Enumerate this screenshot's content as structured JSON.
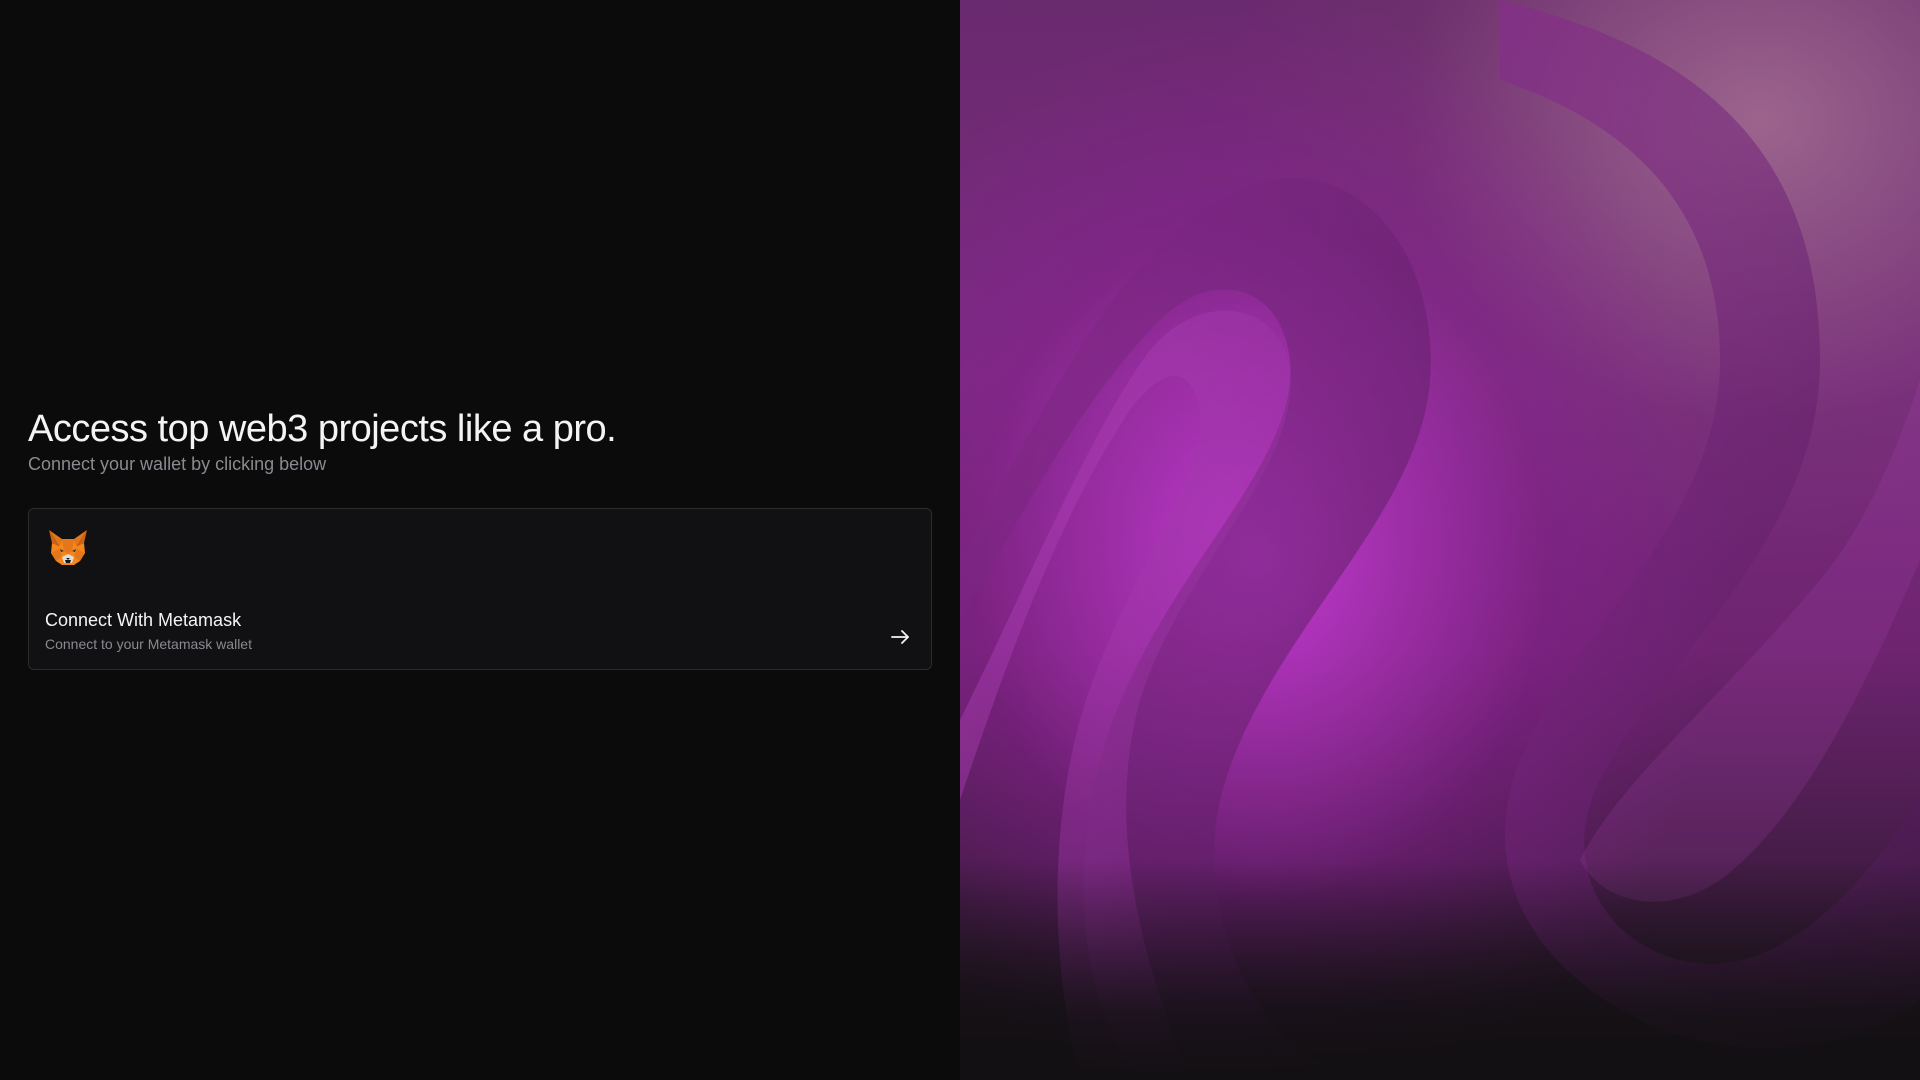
{
  "hero": {
    "headline": "Access top web3 projects like a pro.",
    "subhead": "Connect your wallet by clicking below"
  },
  "wallet_option": {
    "icon": "metamask-fox-icon",
    "title": "Connect With Metamask",
    "subtitle": "Connect to your Metamask wallet",
    "action_icon": "arrow-right-icon"
  },
  "colors": {
    "background": "#0b0b0c",
    "card_background": "#111113",
    "card_border": "#2c2c30",
    "text_primary": "#f4f4f5",
    "text_secondary": "#8a8a90",
    "accent_purple": "#a532b4",
    "fox_orange": "#e2761b"
  }
}
